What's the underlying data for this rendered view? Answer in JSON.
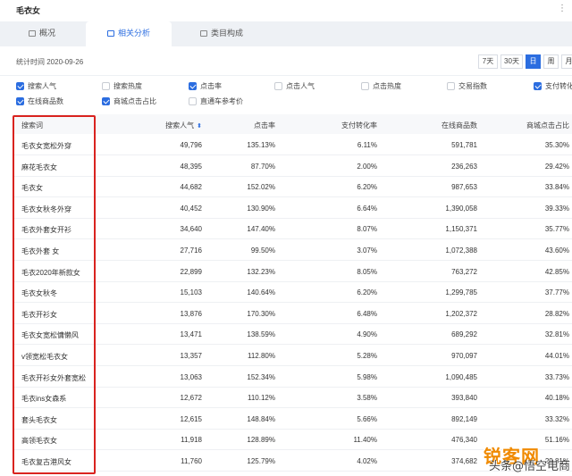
{
  "header": {
    "title": "毛衣女",
    "more": "⋮"
  },
  "tabs": [
    {
      "label": "概况",
      "active": false
    },
    {
      "label": "相关分析",
      "active": true
    },
    {
      "label": "类目构成",
      "active": false
    }
  ],
  "stat": {
    "label": "统计时间 2020-09-26"
  },
  "periods": [
    {
      "label": "7天",
      "active": false
    },
    {
      "label": "30天",
      "active": false
    },
    {
      "label": "日",
      "active": true
    },
    {
      "label": "周",
      "active": false
    },
    {
      "label": "月",
      "active": false
    }
  ],
  "metrics": [
    {
      "label": "搜索人气",
      "checked": true
    },
    {
      "label": "搜索热度",
      "checked": false
    },
    {
      "label": "点击率",
      "checked": true
    },
    {
      "label": "点击人气",
      "checked": false
    },
    {
      "label": "点击热度",
      "checked": false
    },
    {
      "label": "交易指数",
      "checked": false
    },
    {
      "label": "支付转化",
      "checked": true
    },
    {
      "label": "在线商品数",
      "checked": true
    },
    {
      "label": "商城点击占比",
      "checked": true
    },
    {
      "label": "直通车参考价",
      "checked": false
    }
  ],
  "table": {
    "columns": [
      "搜索词",
      "搜索人气",
      "点击率",
      "支付转化率",
      "在线商品数",
      "商城点击占比"
    ],
    "sort_icon": "⬍",
    "rows": [
      [
        "毛衣女宽松外穿",
        "49,796",
        "135.13%",
        "6.11%",
        "591,781",
        "35.30%"
      ],
      [
        "麻花毛衣女",
        "48,395",
        "87.70%",
        "2.00%",
        "236,263",
        "29.42%"
      ],
      [
        "毛衣女",
        "44,682",
        "152.02%",
        "6.20%",
        "987,653",
        "33.84%"
      ],
      [
        "毛衣女秋冬外穿",
        "40,452",
        "130.90%",
        "6.64%",
        "1,390,058",
        "39.33%"
      ],
      [
        "毛衣外套女开衫",
        "34,640",
        "147.40%",
        "8.07%",
        "1,150,371",
        "35.77%"
      ],
      [
        "毛衣外套 女",
        "27,716",
        "99.50%",
        "3.07%",
        "1,072,388",
        "43.60%"
      ],
      [
        "毛衣2020年新款女",
        "22,899",
        "132.23%",
        "8.05%",
        "763,272",
        "42.85%"
      ],
      [
        "毛衣女秋冬",
        "15,103",
        "140.64%",
        "6.20%",
        "1,299,785",
        "37.77%"
      ],
      [
        "毛衣开衫女",
        "13,876",
        "170.30%",
        "6.48%",
        "1,202,372",
        "28.82%"
      ],
      [
        "毛衣女宽松慵懒风",
        "13,471",
        "138.59%",
        "4.90%",
        "689,292",
        "32.81%"
      ],
      [
        "v领宽松毛衣女",
        "13,357",
        "112.80%",
        "5.28%",
        "970,097",
        "44.01%"
      ],
      [
        "毛衣开衫女外套宽松",
        "13,063",
        "152.34%",
        "5.98%",
        "1,090,485",
        "33.73%"
      ],
      [
        "毛衣ins女森系",
        "12,672",
        "110.12%",
        "3.58%",
        "393,840",
        "40.18%"
      ],
      [
        "套头毛衣女",
        "12,615",
        "148.84%",
        "5.66%",
        "892,149",
        "33.32%"
      ],
      [
        "高领毛衣女",
        "11,918",
        "128.89%",
        "11.40%",
        "476,340",
        "51.16%"
      ],
      [
        "毛衣复古港风女",
        "11,760",
        "125.79%",
        "4.02%",
        "374,682",
        "29.81%"
      ]
    ]
  },
  "watermark": {
    "main": "锐客网",
    "sub": "头条@悟空电商"
  },
  "colors": {
    "accent": "#2b6de0",
    "highlight_box": "#d9231f",
    "watermark": "#f08a00"
  }
}
